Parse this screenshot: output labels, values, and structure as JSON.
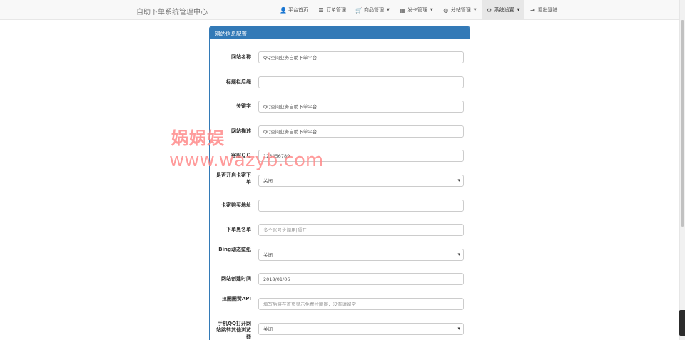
{
  "navbar": {
    "brand": "自助下单系统管理中心",
    "items": [
      {
        "label": "平台首页",
        "icon": "user-icon",
        "glyph": "👤",
        "dropdown": false,
        "active": false
      },
      {
        "label": "订单管理",
        "icon": "list-icon",
        "glyph": "☰",
        "dropdown": false,
        "active": false
      },
      {
        "label": "商品管理",
        "icon": "shopping-cart-icon",
        "glyph": "🛒",
        "dropdown": true,
        "active": false
      },
      {
        "label": "发卡管理",
        "icon": "grid-icon",
        "glyph": "▦",
        "dropdown": true,
        "active": false
      },
      {
        "label": "分站管理",
        "icon": "globe-icon",
        "glyph": "◍",
        "dropdown": true,
        "active": false
      },
      {
        "label": "系统设置",
        "icon": "gear-icon",
        "glyph": "⚙",
        "dropdown": true,
        "active": true
      },
      {
        "label": "退出登陆",
        "icon": "logout-icon",
        "glyph": "⇥",
        "dropdown": false,
        "active": false
      }
    ]
  },
  "panel": {
    "title": "网站信息配置",
    "fields": [
      {
        "label": "网站名称",
        "type": "input",
        "value": "QQ空间业务自助下单平台",
        "placeholder": ""
      },
      {
        "label": "标题栏后缀",
        "type": "input",
        "value": "",
        "placeholder": ""
      },
      {
        "label": "关键字",
        "type": "input",
        "value": "QQ空间业务自助下单平台",
        "placeholder": ""
      },
      {
        "label": "网站描述",
        "type": "input",
        "value": "QQ空间业务自助下单平台",
        "placeholder": ""
      },
      {
        "label": "客服ＱＱ",
        "type": "input",
        "value": "123456789",
        "placeholder": ""
      },
      {
        "label": "是否开启卡密下单",
        "type": "select",
        "value": "关闭",
        "placeholder": ""
      },
      {
        "label": "卡密购买地址",
        "type": "input",
        "value": "",
        "placeholder": ""
      },
      {
        "label": "下单黑名单",
        "type": "input",
        "value": "",
        "placeholder": "多个账号之间用|隔开"
      },
      {
        "label": "Bing动态壁纸",
        "type": "select",
        "value": "关闭",
        "placeholder": ""
      },
      {
        "label": "网站创建时间",
        "type": "input",
        "value": "2018/01/06",
        "placeholder": ""
      },
      {
        "label": "拉圈圈赞API",
        "type": "input",
        "value": "",
        "placeholder": "填写后将在首页显示免费拉圈圈，没有请留空"
      },
      {
        "label": "手机QQ打开网站跳转其他浏览器",
        "type": "select",
        "value": "关闭",
        "placeholder": ""
      }
    ]
  },
  "watermark": {
    "line1": "娲娲娱",
    "line2": "www.wazyb.com"
  }
}
